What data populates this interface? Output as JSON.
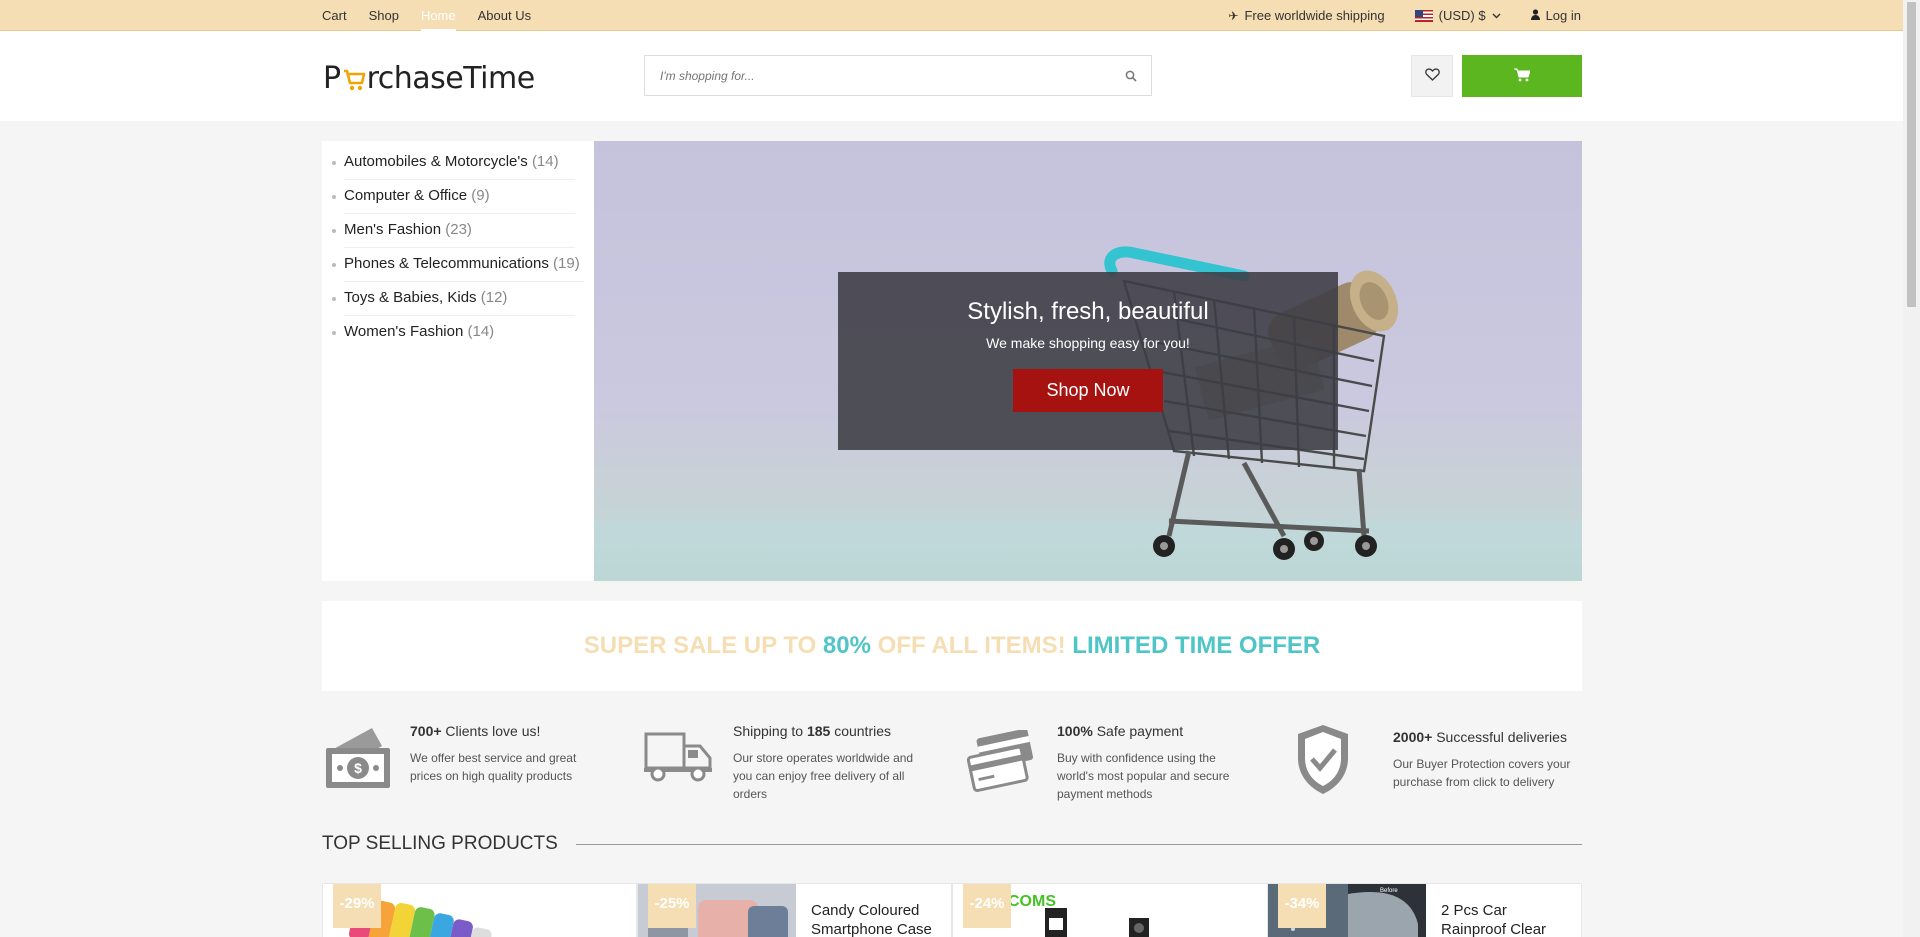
{
  "topnav": {
    "links": [
      "Cart",
      "Shop",
      "Home",
      "About Us"
    ],
    "active": "Home"
  },
  "topbar": {
    "shipping": "Free worldwide shipping",
    "currency": "(USD) $",
    "login": "Log in"
  },
  "header": {
    "logo_left": "P",
    "logo_right": "rchaseTime",
    "search_placeholder": "I'm shopping for..."
  },
  "categories": [
    {
      "name": "Automobiles & Motorcycle's",
      "count": "(14)"
    },
    {
      "name": "Computer & Office",
      "count": "(9)"
    },
    {
      "name": "Men's Fashion",
      "count": "(23)"
    },
    {
      "name": "Phones & Telecommunications",
      "count": "(19)"
    },
    {
      "name": "Toys & Babies, Kids",
      "count": "(12)"
    },
    {
      "name": "Women's Fashion",
      "count": "(14)"
    }
  ],
  "hero": {
    "title": "Stylish, fresh, beautiful",
    "subtitle": "We make shopping easy for you!",
    "button": "Shop Now"
  },
  "sale": {
    "part1": "SUPER SALE UP TO ",
    "part2": "80%",
    "part3": " OFF ALL ITEMS! ",
    "part4": "LIMITED TIME OFFER"
  },
  "features": [
    {
      "bold": "700+",
      "title": " Clients love us!",
      "desc": [
        "We offer best service and great",
        "prices on high quality products"
      ]
    },
    {
      "pre": "Shipping to ",
      "bold": "185",
      "title": " countries",
      "desc": [
        "Our store operates worldwide and",
        "you can enjoy free delivery of all",
        "orders"
      ]
    },
    {
      "bold": "100%",
      "title": " Safe payment",
      "desc": [
        "Buy with confidence using the",
        "world's most popular and secure",
        "payment methods"
      ]
    },
    {
      "bold": "2000+",
      "title": " Successful deliveries",
      "desc": [
        "Our Buyer Protection covers your",
        "purchase from click to delivery"
      ]
    }
  ],
  "top_selling": {
    "heading": "TOP SELLING PRODUCTS",
    "products": [
      {
        "discount": "-29%",
        "name": ""
      },
      {
        "discount": "-25%",
        "name": "Candy Coloured Smartphone Case"
      },
      {
        "discount": "-24%",
        "name": ""
      },
      {
        "discount": "-34%",
        "name": "2 Pcs Car Rainproof Clear"
      }
    ]
  },
  "colors": {
    "topbar": "#f5deb3",
    "cart_button": "#5cb61f",
    "shop_now": "#a5120f",
    "sale_accent": "#4fc5c7"
  }
}
